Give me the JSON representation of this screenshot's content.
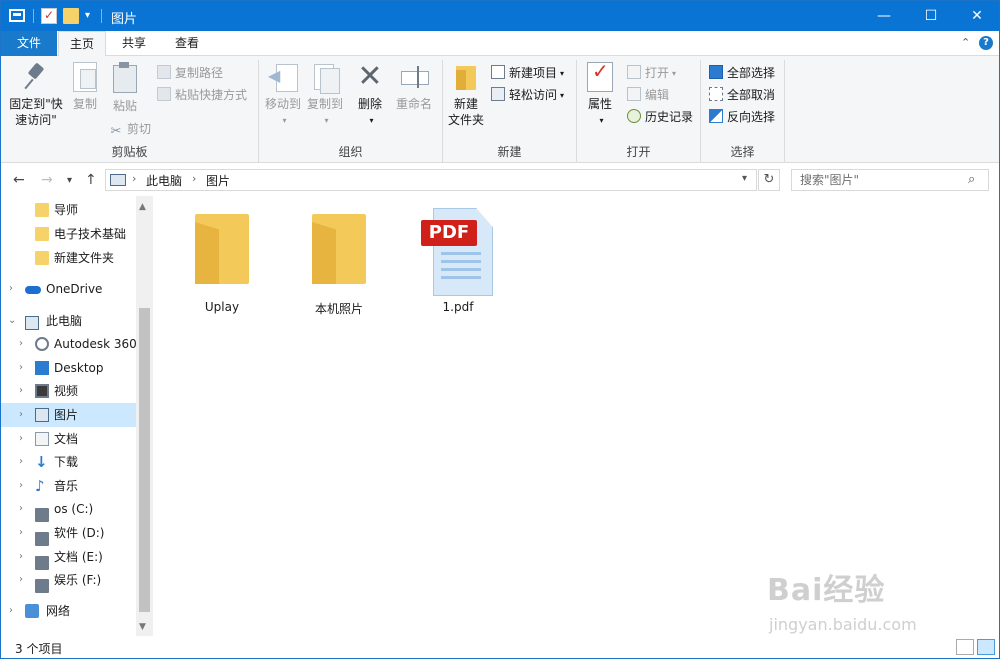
{
  "window": {
    "title": "图片",
    "controls": {
      "minimize": "—",
      "maximize": "☐",
      "close": "✕"
    }
  },
  "ribbon_tabs": [
    "文件",
    "主页",
    "共享",
    "查看"
  ],
  "ribbon": {
    "clipboard": {
      "label": "剪贴板",
      "pin_line1": "固定到\"快",
      "pin_line2": "速访问\"",
      "copy": "复制",
      "paste": "粘贴",
      "copy_path": "复制路径",
      "paste_shortcut": "粘贴快捷方式",
      "cut": "剪切"
    },
    "organize": {
      "label": "组织",
      "move_to": "移动到",
      "copy_to": "复制到",
      "delete": "删除",
      "rename": "重命名"
    },
    "new": {
      "label": "新建",
      "new_item": "新建项目",
      "easy_access": "轻松访问",
      "new_folder_line1": "新建",
      "new_folder_line2": "文件夹"
    },
    "open": {
      "label": "打开",
      "properties": "属性",
      "open": "打开",
      "edit": "编辑",
      "history": "历史记录"
    },
    "select": {
      "label": "选择",
      "select_all": "全部选择",
      "select_none": "全部取消",
      "invert": "反向选择"
    }
  },
  "address": {
    "crumbs": [
      "此电脑",
      "图片"
    ],
    "search_placeholder": "搜索\"图片\""
  },
  "sidebar": {
    "items": [
      {
        "label": "导师",
        "icon": "folder-icon"
      },
      {
        "label": "电子技术基础",
        "icon": "folder-icon"
      },
      {
        "label": "新建文件夹",
        "icon": "folder-icon"
      },
      {
        "label": "OneDrive",
        "icon": "onedrive-icon"
      },
      {
        "label": "此电脑",
        "icon": "computer-icon"
      },
      {
        "label": "Autodesk 360",
        "icon": "autodesk-icon"
      },
      {
        "label": "Desktop",
        "icon": "desktop-icon"
      },
      {
        "label": "视频",
        "icon": "video-icon"
      },
      {
        "label": "图片",
        "icon": "pictures-icon",
        "selected": true
      },
      {
        "label": "文档",
        "icon": "documents-icon"
      },
      {
        "label": "下载",
        "icon": "downloads-icon"
      },
      {
        "label": "音乐",
        "icon": "music-icon"
      },
      {
        "label": "os (C:)",
        "icon": "drive-icon"
      },
      {
        "label": "软件 (D:)",
        "icon": "drive-icon"
      },
      {
        "label": "文档 (E:)",
        "icon": "drive-icon"
      },
      {
        "label": "娱乐 (F:)",
        "icon": "drive-icon"
      },
      {
        "label": "网络",
        "icon": "network-icon"
      }
    ]
  },
  "files": [
    {
      "name": "Uplay",
      "type": "folder"
    },
    {
      "name": "本机照片",
      "type": "folder"
    },
    {
      "name": "1.pdf",
      "type": "pdf",
      "badge": "PDF"
    }
  ],
  "status": {
    "count": "3 个项目"
  },
  "watermark": {
    "line1": "Bai经验",
    "line2": "jingyan.baidu.com"
  }
}
